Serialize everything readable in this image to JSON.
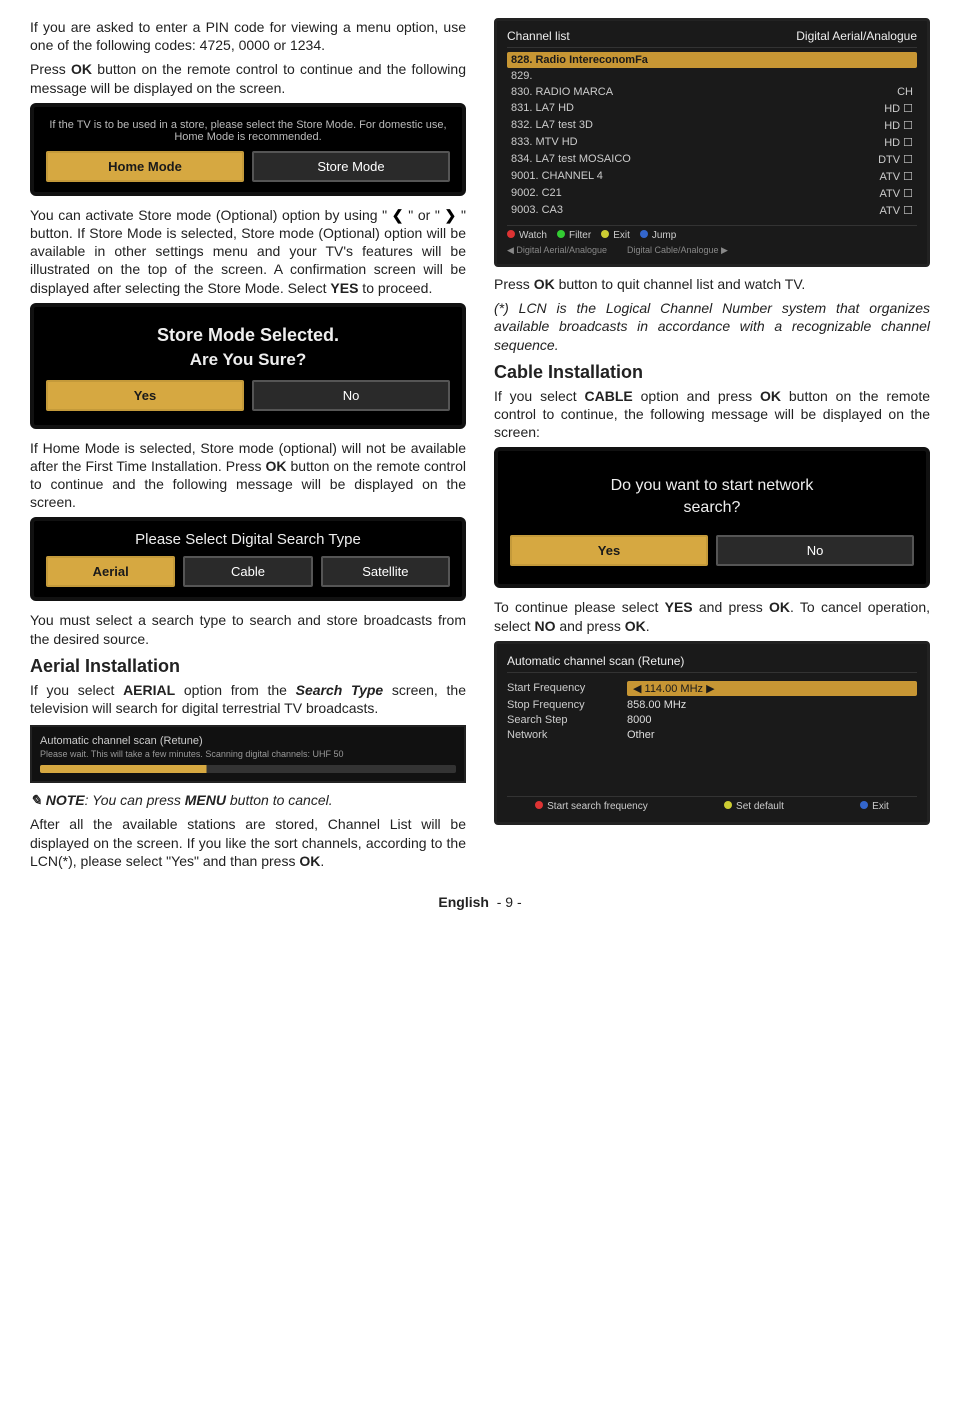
{
  "left": {
    "p1a": "If you are asked to enter a PIN code for viewing a menu option, use one of the following codes: 4725, 0000 or 1234.",
    "p1b_pre": "Press ",
    "p1b_ok": "OK",
    "p1b_post": " button on the remote control to continue and the following message will be displayed on the screen.",
    "store_hint_msg": "If the TV is to be used in a store, please select the Store Mode. For domestic use, Home Mode is recommended.",
    "store_hint_btn1": "Home Mode",
    "store_hint_btn2": "Store Mode",
    "p2_a": "You can activate Store mode (Optional) option by using \" ",
    "p2_b": " \" or \" ",
    "p2_c": " \" button. If Store Mode is selected, Store mode (Optional) option will be available in other settings menu and your TV's features will be illustrated on the top of the screen. A confirmation screen will be displayed after selecting the Store Mode. Select ",
    "p2_yes": "YES",
    "p2_d": " to proceed.",
    "dialog_line1": "Store Mode Selected.",
    "dialog_line2": "Are You Sure?",
    "dialog_yes": "Yes",
    "dialog_no": "No",
    "p3_a": "If Home Mode is selected, Store mode (optional) will not be available after the First Time Installation. Press ",
    "p3_ok": "OK",
    "p3_b": " button on the remote control to continue and the following message will be displayed on the screen.",
    "search_title": "Please Select Digital Search Type",
    "search_b1": "Aerial",
    "search_b2": "Cable",
    "search_b3": "Satellite",
    "p4": "You must select a search type to search and store broadcasts from the desired source.",
    "h_aerial": "Aerial Installation",
    "p5_a": "If you select ",
    "p5_aerial": "AERIAL",
    "p5_b": " option from the ",
    "p5_st": "Search Type",
    "p5_c": " screen, the television will search for digital terrestrial TV broadcasts.",
    "scan_title": "Automatic channel scan (Retune)",
    "scan_sub": "Please wait. This will take a few minutes. Scanning digital channels: UHF 50",
    "note_label": "NOTE",
    "note_body": ": You can press ",
    "note_menu": "MENU",
    "note_body2": " button to cancel.",
    "p6_a": "After all the available stations are stored, Channel List will be displayed on the screen. If you like the sort channels, according to the LCN(*), please select \"Yes\" and than press ",
    "p6_ok": "OK",
    "p6_b": "."
  },
  "right": {
    "cl_title": "Channel list",
    "cl_right": "Digital Aerial/Analogue",
    "cl_rows": [
      {
        "name": "828. Radio IntereconomFa",
        "tag": ""
      },
      {
        "name": "829.",
        "tag": ""
      },
      {
        "name": "830. RADIO MARCA",
        "tag": "CH"
      },
      {
        "name": "831. LA7 HD",
        "tag": "HD ☐"
      },
      {
        "name": "832. LA7 test 3D",
        "tag": "HD ☐"
      },
      {
        "name": "833. MTV HD",
        "tag": "HD ☐"
      },
      {
        "name": "834. LA7 test MOSAICO",
        "tag": "DTV ☐"
      },
      {
        "name": "9001. CHANNEL 4",
        "tag": "ATV ☐"
      },
      {
        "name": "9002. C21",
        "tag": "ATV ☐"
      },
      {
        "name": "9003. CA3",
        "tag": "ATV ☐"
      }
    ],
    "cl_btns": {
      "r": "Watch",
      "g": "Filter",
      "y": "Exit",
      "b": "Jump"
    },
    "cl_foot1": "Digital Aerial/Analogue",
    "cl_foot2": "Digital Cable/Analogue",
    "p1_a": "Press ",
    "p1_ok": "OK",
    "p1_b": " button to quit channel list and watch TV.",
    "p2": "(*) LCN is the Logical Channel Number system that organizes available broadcasts in accordance with a recognizable channel sequence.",
    "h_cable": "Cable Installation",
    "p3_a": "If you select ",
    "p3_cable": "CABLE",
    "p3_b": " option and press ",
    "p3_ok": "OK",
    "p3_c": " button on the remote control to continue, the following message will be displayed on the screen:",
    "nw_line1": "Do you want to start network",
    "nw_line2": "search?",
    "nw_yes": "Yes",
    "nw_no": "No",
    "p4_a": "To continue please select ",
    "p4_yes": "YES",
    "p4_b": " and press ",
    "p4_ok1": "OK",
    "p4_c": ". To cancel operation, select ",
    "p4_no": "NO",
    "p4_d": " and press ",
    "p4_ok2": "OK",
    "p4_e": ".",
    "form_title": "Automatic channel scan (Retune)",
    "frows": [
      {
        "label": "Start Frequency",
        "val": "114.00 MHz",
        "sel": true
      },
      {
        "label": "Stop Frequency",
        "val": "858.00 MHz",
        "sel": false
      },
      {
        "label": "Search Step",
        "val": "8000",
        "sel": false
      },
      {
        "label": "Network",
        "val": "Other",
        "sel": false
      }
    ],
    "form_b1": "Start search frequency",
    "form_b2": "Set default",
    "form_b3": "Exit"
  },
  "footer": {
    "lang": "English",
    "page": "- 9 -"
  }
}
